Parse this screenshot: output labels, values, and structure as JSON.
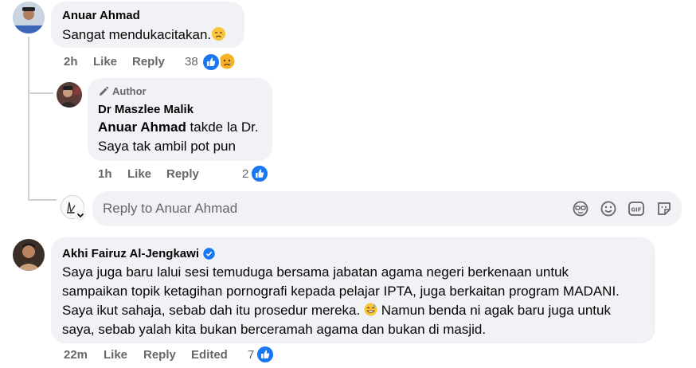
{
  "comment1": {
    "author": "Anuar Ahmad",
    "text": "Sangat mendukacitakan.",
    "time": "2h",
    "like_label": "Like",
    "reply_label": "Reply",
    "reaction_count": "38"
  },
  "reply1": {
    "badge_label": "Author",
    "author": "Dr Maszlee Malik",
    "mention": "Anuar Ahmad",
    "text_line1_rest": " takde la Dr.",
    "text_line2": "Saya tak ambil pot pun",
    "time": "1h",
    "like_label": "Like",
    "reply_label": "Reply",
    "reaction_count": "2"
  },
  "reply_box": {
    "placeholder": "Reply to Anuar Ahmad",
    "icons": [
      "avatar-icon",
      "sticker-face-icon",
      "emoji-icon",
      "gif-icon",
      "sticker-icon"
    ]
  },
  "comment2": {
    "author": "Akhi Fairuz Al-Jengkawi",
    "verified": true,
    "line1": "Saya juga baru lalui sesi temuduga bersama jabatan agama negeri berkenaan untuk",
    "line2": "sampaikan topik ketagihan pornografi kepada pelajar IPTA, juga berkaitan program MADANI.",
    "line3": "Saya ikut sahaja, sebab dah itu prosedur mereka.",
    "line3_rest": " Namun benda ni agak baru juga untuk",
    "line4": "saya, sebab yalah kita bukan berceramah agama dan bukan di masjid.",
    "time": "22m",
    "like_label": "Like",
    "reply_label": "Reply",
    "edited_label": "Edited",
    "reaction_count": "7"
  },
  "colors": {
    "bubble": "#f0f2f5",
    "like_blue": "#1877f2",
    "muted_text": "#65676b",
    "thread_line": "#ced0d4"
  }
}
